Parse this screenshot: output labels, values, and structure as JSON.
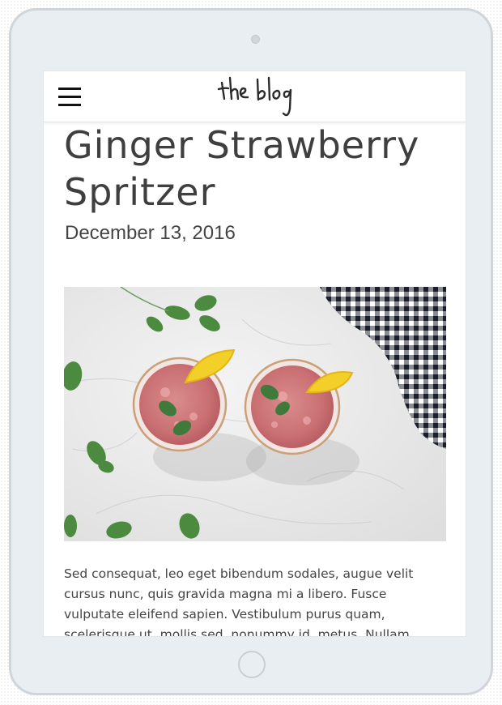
{
  "header": {
    "logo_text": "the blog"
  },
  "post": {
    "title": "Ginger Strawberry Spritzer",
    "date": "December 13, 2016",
    "body": "Sed consequat, leo eget bibendum sodales, augue velit cursus nunc, quis gravida magna mi a libero. Fusce vulputate eleifend sapien. Vestibulum purus quam, scelerisque ut, mollis sed, nonummy id, metus. Nullam"
  },
  "icons": {
    "menu": "hamburger-menu-icon"
  }
}
